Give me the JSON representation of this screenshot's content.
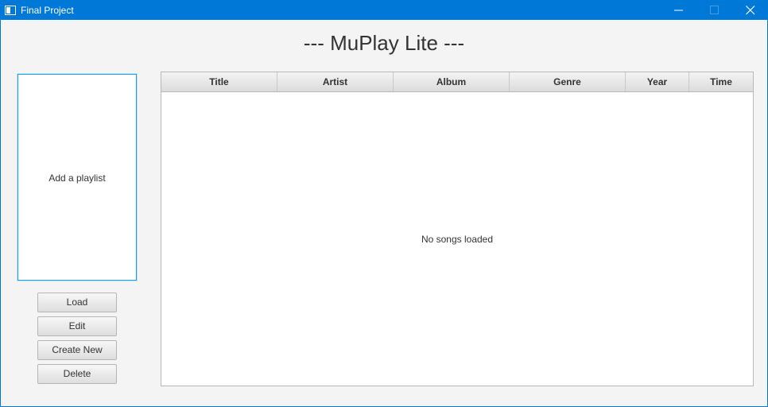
{
  "window": {
    "title": "Final Project"
  },
  "app": {
    "heading": "--- MuPlay Lite ---"
  },
  "playlist": {
    "placeholder": "Add a playlist"
  },
  "buttons": {
    "load": "Load",
    "edit": "Edit",
    "create_new": "Create New",
    "delete": "Delete"
  },
  "table": {
    "columns": [
      "Title",
      "Artist",
      "Album",
      "Genre",
      "Year",
      "Time"
    ],
    "empty_message": "No songs loaded"
  },
  "colors": {
    "titlebar": "#0078d7",
    "focus_border": "#1ea0e8"
  },
  "icons": {
    "app": "window-icon",
    "minimize": "minimize-icon",
    "maximize": "maximize-icon",
    "close": "close-icon"
  }
}
